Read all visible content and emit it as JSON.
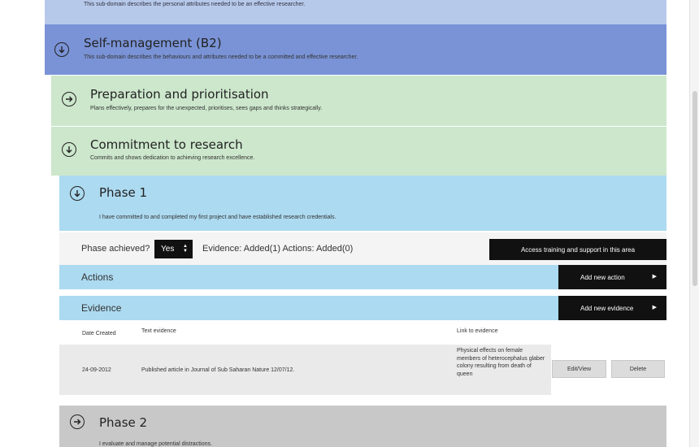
{
  "top_strip": {
    "desc": "This sub-domain describes the personal attributes needed to be an effective researcher."
  },
  "b2": {
    "title": "Self-management (B2)",
    "desc": "This sub-domain describes the behaviours and attributes needed to be a committed and effective researcher."
  },
  "prep": {
    "title": "Preparation and prioritisation",
    "desc": "Plans effectively, prepares for the unexpected, prioritises, sees gaps and thinks strategically."
  },
  "commit": {
    "title": "Commitment to research",
    "desc": "Commits and shows dedication to achieving research excellence."
  },
  "phase1": {
    "title": "Phase 1",
    "desc": "I have committed to and completed my first project and have established research credentials.",
    "achieved_label": "Phase achieved?",
    "achieved_value": "Yes",
    "counts": "Evidence: Added(1) Actions: Added(0)",
    "access_button": "Access training and support in this area"
  },
  "actions": {
    "title": "Actions",
    "button": "Add new action"
  },
  "evidence": {
    "title": "Evidence",
    "button": "Add new evidence",
    "headers": {
      "date": "Date Created",
      "text": "Text evidence",
      "link": "Link to evidence"
    },
    "rows": [
      {
        "date": "24-09-2012",
        "text": "Published article in Journal of Sub Saharan Nature 12/07/12.",
        "link": "Physical effects on female members of heterocephalus glaber colony resulting from death of queen",
        "edit": "Edit/View",
        "delete": "Delete"
      }
    ]
  },
  "phase2": {
    "title": "Phase 2",
    "desc": "I evaluate and manage potential distractions."
  },
  "colors": {
    "b2": "#7a93d6",
    "green": "#cce7cc",
    "blue": "#acdaf0",
    "grey": "#c8c8c8",
    "button": "#111111"
  }
}
